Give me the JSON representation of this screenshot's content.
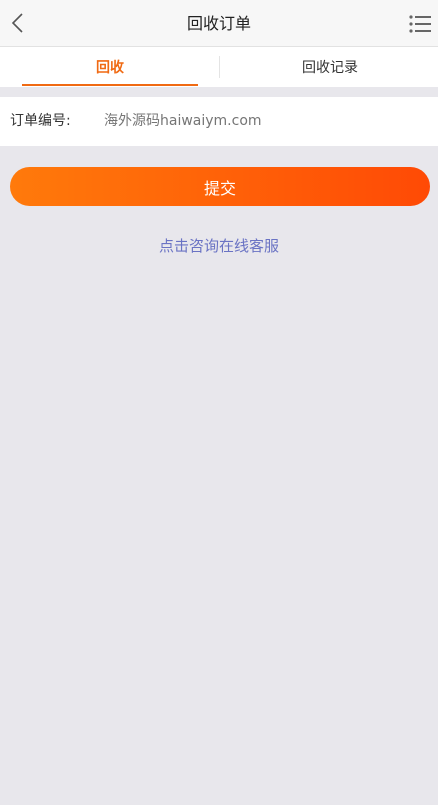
{
  "header": {
    "title": "回收订单",
    "back_icon": "chevron-left-icon",
    "menu_icon": "list-menu-icon"
  },
  "tabs": [
    {
      "label": "回收",
      "active": true
    },
    {
      "label": "回收记录",
      "active": false
    }
  ],
  "form": {
    "order_label": "订单编号:",
    "order_placeholder": "海外源码haiwaiym.com"
  },
  "submit_label": "提交",
  "service_link": "点击咨询在线客服",
  "colors": {
    "accent": "#f06a13",
    "button_start": "#ff7a0b",
    "button_end": "#ff4a05",
    "link": "#6a73c4",
    "background": "#e8e7ec"
  }
}
